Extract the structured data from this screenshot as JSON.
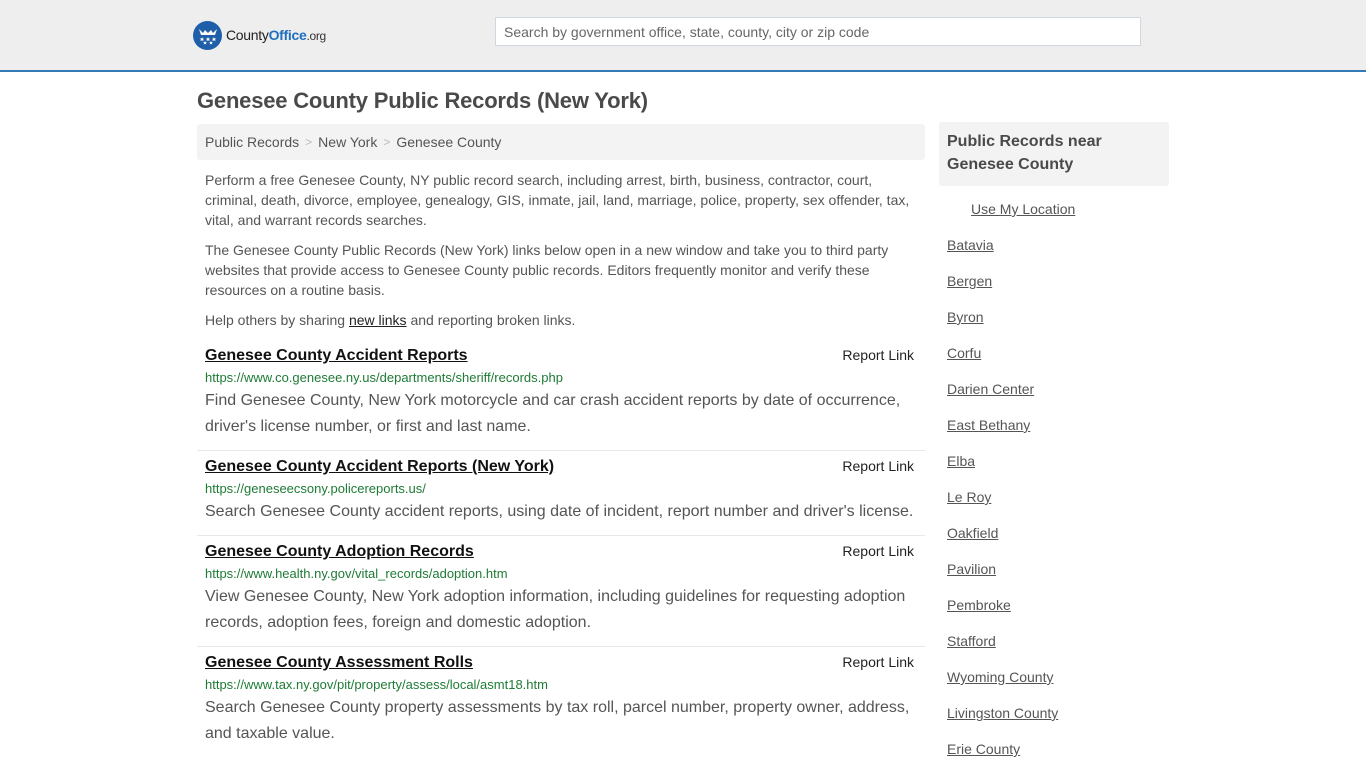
{
  "header": {
    "logo": {
      "icon": "eagle-stars-badge-icon",
      "text_main": "County",
      "text_brand": "Office",
      "text_tld": ".org"
    },
    "search": {
      "placeholder": "Search by government office, state, county, city or zip code",
      "value": ""
    },
    "colors": {
      "accent": "#337ab7",
      "topbar_bg": "#eeeeee",
      "link_green": "#1e7b35"
    }
  },
  "page": {
    "title": "Genesee County Public Records (New York)"
  },
  "breadcrumb": {
    "items": [
      "Public Records",
      "New York",
      "Genesee County"
    ],
    "separator": ">"
  },
  "intro": {
    "p1": "Perform a free Genesee County, NY public record search, including arrest, birth, business, contractor, court, criminal, death, divorce, employee, genealogy, GIS, inmate, jail, land, marriage, police, property, sex offender, tax, vital, and warrant records searches.",
    "p2": "The Genesee County Public Records (New York) links below open in a new window and take you to third party websites that provide access to Genesee County public records. Editors frequently monitor and verify these resources on a routine basis.",
    "p3_before": "Help others by sharing ",
    "p3_link": "new links",
    "p3_after": " and reporting broken links."
  },
  "records": [
    {
      "title": "Genesee County Accident Reports",
      "report_label": "Report Link",
      "url": "https://www.co.genesee.ny.us/departments/sheriff/records.php",
      "description": "Find Genesee County, New York motorcycle and car crash accident reports by date of occurrence, driver's license number, or first and last name."
    },
    {
      "title": "Genesee County Accident Reports (New York)",
      "report_label": "Report Link",
      "url": "https://geneseecsony.policereports.us/",
      "description": "Search Genesee County accident reports, using date of incident, report number and driver's license."
    },
    {
      "title": "Genesee County Adoption Records",
      "report_label": "Report Link",
      "url": "https://www.health.ny.gov/vital_records/adoption.htm",
      "description": "View Genesee County, New York adoption information, including guidelines for requesting adoption records, adoption fees, foreign and domestic adoption."
    },
    {
      "title": "Genesee County Assessment Rolls",
      "report_label": "Report Link",
      "url": "https://www.tax.ny.gov/pit/property/assess/local/asmt18.htm",
      "description": "Search Genesee County property assessments by tax roll, parcel number, property owner, address, and taxable value."
    }
  ],
  "sidebar": {
    "heading": "Public Records near Genesee County",
    "use_location": "Use My Location",
    "links": [
      "Batavia",
      "Bergen",
      "Byron",
      "Corfu",
      "Darien Center",
      "East Bethany",
      "Elba",
      "Le Roy",
      "Oakfield",
      "Pavilion",
      "Pembroke",
      "Stafford",
      "Wyoming County",
      "Livingston County",
      "Erie County"
    ]
  }
}
